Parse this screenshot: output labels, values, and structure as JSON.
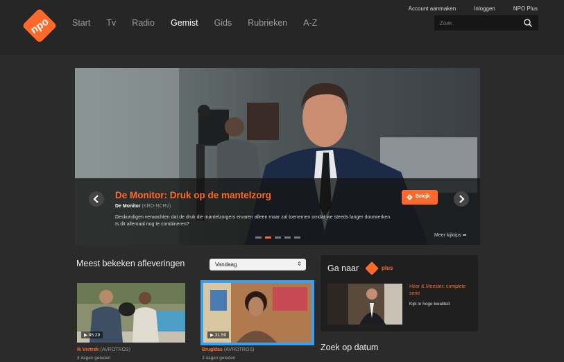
{
  "header": {
    "logo_text": "npo",
    "nav": [
      "Start",
      "Tv",
      "Radio",
      "Gemist",
      "Gids",
      "Rubrieken",
      "A-Z"
    ],
    "nav_active": "Gemist",
    "links": [
      "Account aanmaken",
      "Inloggen",
      "NPO Plus"
    ],
    "search_placeholder": "Zoek"
  },
  "hero": {
    "title": "De Monitor: Druk op de mantelzorg",
    "program": "De Monitor",
    "broadcaster": "(KRO-NCRV)",
    "description": "Deskundigen verwachten dat de druk die mantelzorgers ervaren alleen maar zal toenemen omdat we steeds langer doorwerken. Is dit allemaal nog te combineren?",
    "watch_label": "Bekijk",
    "more_label": "Meer kijktips",
    "dot_count": 5,
    "active_dot": 1
  },
  "most_viewed": {
    "heading": "Meest bekeken afleveringen",
    "filter_value": "Vandaag",
    "items": [
      {
        "duration": "45:29",
        "title": "Ik Vertrek",
        "broadcaster": "(AVROTROS)",
        "date": "3 dagen geleden"
      },
      {
        "duration": "31:59",
        "title": "Brugklas",
        "broadcaster": "(AVROTROS)",
        "date": "3 dagen geleden"
      }
    ]
  },
  "npo_plus": {
    "heading": "Ga naar",
    "plus_label": "plus",
    "promo_title": "Heer & Meester: complete serie",
    "promo_sub": "Kijk in hoge kwaliteit"
  },
  "date_search": {
    "heading": "Zoek op datum"
  },
  "colors": {
    "accent": "#ff6a2c",
    "background": "#2b2b2b",
    "selected_outline": "#3aa0f0"
  }
}
